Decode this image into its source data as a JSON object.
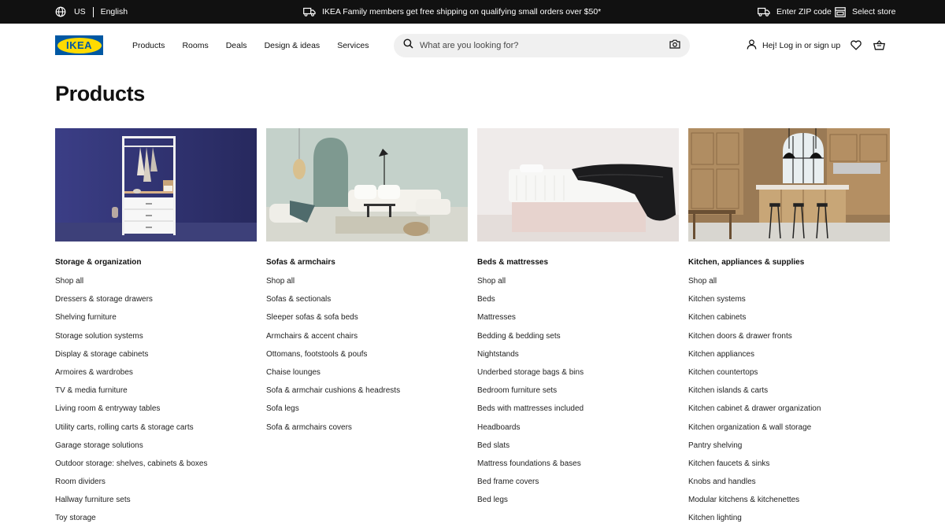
{
  "topbar": {
    "country": "US",
    "language": "English",
    "promo": "IKEA Family members get free shipping on qualifying small orders over $50*",
    "zip_label": "Enter ZIP code",
    "store_label": "Select store"
  },
  "header": {
    "logo_text": "IKEA",
    "nav": [
      "Products",
      "Rooms",
      "Deals",
      "Design & ideas",
      "Services"
    ],
    "search_placeholder": "What are you looking for?",
    "account_label": "Hej! Log in or sign up"
  },
  "page": {
    "title": "Products"
  },
  "categories": [
    {
      "title": "Storage & organization",
      "items": [
        "Shop all",
        "Dressers & storage drawers",
        "Shelving furniture",
        "Storage solution systems",
        "Display & storage cabinets",
        "Armoires & wardrobes",
        "TV & media furniture",
        "Living room & entryway tables",
        "Utility carts, rolling carts & storage carts",
        "Garage storage solutions",
        "Outdoor storage: shelves, cabinets & boxes",
        "Room dividers",
        "Hallway furniture sets",
        "Toy storage"
      ]
    },
    {
      "title": "Sofas & armchairs",
      "items": [
        "Shop all",
        "Sofas & sectionals",
        "Sleeper sofas & sofa beds",
        "Armchairs & accent chairs",
        "Ottomans, footstools & poufs",
        "Chaise lounges",
        "Sofa & armchair cushions & headrests",
        "Sofa legs",
        "Sofa & armchairs covers"
      ]
    },
    {
      "title": "Beds & mattresses",
      "items": [
        "Shop all",
        "Beds",
        "Mattresses",
        "Bedding & bedding sets",
        "Nightstands",
        "Underbed storage bags & bins",
        "Bedroom furniture sets",
        "Beds with mattresses included",
        "Headboards",
        "Bed slats",
        "Mattress foundations & bases",
        "Bed frame covers",
        "Bed legs"
      ]
    },
    {
      "title": "Kitchen, appliances & supplies",
      "items": [
        "Shop all",
        "Kitchen systems",
        "Kitchen cabinets",
        "Kitchen doors & drawer fronts",
        "Kitchen appliances",
        "Kitchen countertops",
        "Kitchen islands & carts",
        "Kitchen cabinet & drawer organization",
        "Kitchen organization & wall storage",
        "Pantry shelving",
        "Kitchen faucets & sinks",
        "Knobs and handles",
        "Modular kitchens & kitchenettes",
        "Kitchen lighting"
      ]
    }
  ],
  "colors": {
    "topbar_bg": "#111111",
    "brand_blue": "#0058a3",
    "brand_yellow": "#ffdb00",
    "search_bg": "#f0f0f0"
  },
  "icons": [
    "globe-icon",
    "truck-icon",
    "store-icon",
    "search-icon",
    "camera-icon",
    "user-icon",
    "heart-icon",
    "cart-icon"
  ]
}
